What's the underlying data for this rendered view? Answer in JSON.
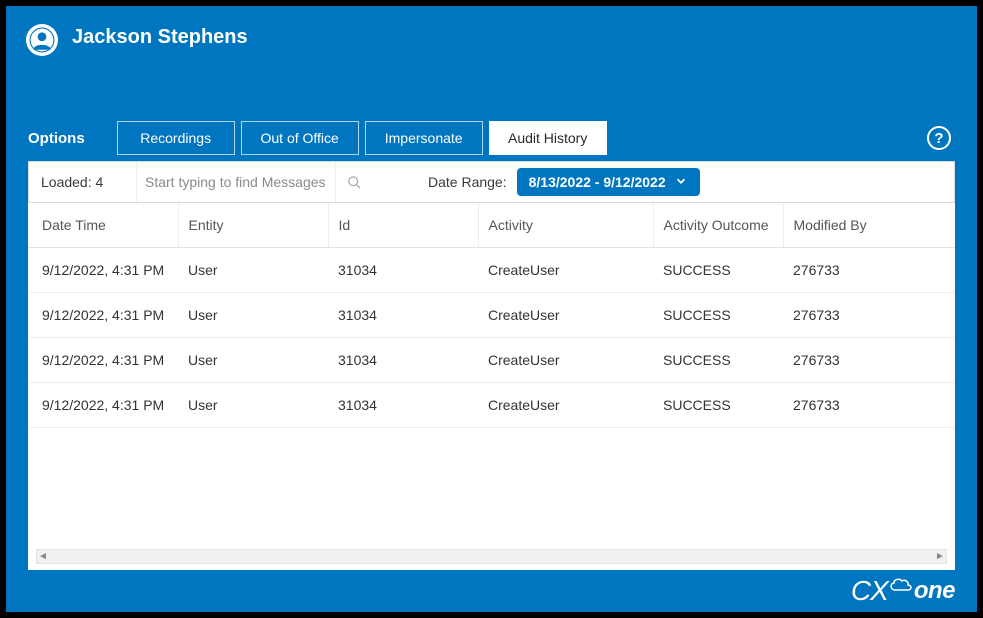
{
  "header": {
    "user_name": "Jackson Stephens"
  },
  "tabbar": {
    "options_label": "Options",
    "tabs": [
      {
        "label": "Recordings",
        "active": false
      },
      {
        "label": "Out of Office",
        "active": false
      },
      {
        "label": "Impersonate",
        "active": false
      },
      {
        "label": "Audit History",
        "active": true
      }
    ],
    "help_tooltip": "?"
  },
  "toolbar": {
    "loaded_prefix": "Loaded:",
    "loaded_count": "4",
    "search_placeholder": "Start typing to find Messages",
    "date_range_label": "Date Range:",
    "date_range_value": "8/13/2022 - 9/12/2022"
  },
  "table": {
    "columns": [
      "Date Time",
      "Entity",
      "Id",
      "Activity",
      "Activity Outcome",
      "Modified By"
    ],
    "rows": [
      {
        "datetime": "9/12/2022, 4:31 PM",
        "entity": "User",
        "id": "31034",
        "activity": "CreateUser",
        "outcome": "SUCCESS",
        "modified_by": "276733"
      },
      {
        "datetime": "9/12/2022, 4:31 PM",
        "entity": "User",
        "id": "31034",
        "activity": "CreateUser",
        "outcome": "SUCCESS",
        "modified_by": "276733"
      },
      {
        "datetime": "9/12/2022, 4:31 PM",
        "entity": "User",
        "id": "31034",
        "activity": "CreateUser",
        "outcome": "SUCCESS",
        "modified_by": "276733"
      },
      {
        "datetime": "9/12/2022, 4:31 PM",
        "entity": "User",
        "id": "31034",
        "activity": "CreateUser",
        "outcome": "SUCCESS",
        "modified_by": "276733"
      }
    ]
  },
  "footer": {
    "brand_cx": "CX",
    "brand_one": "one"
  }
}
